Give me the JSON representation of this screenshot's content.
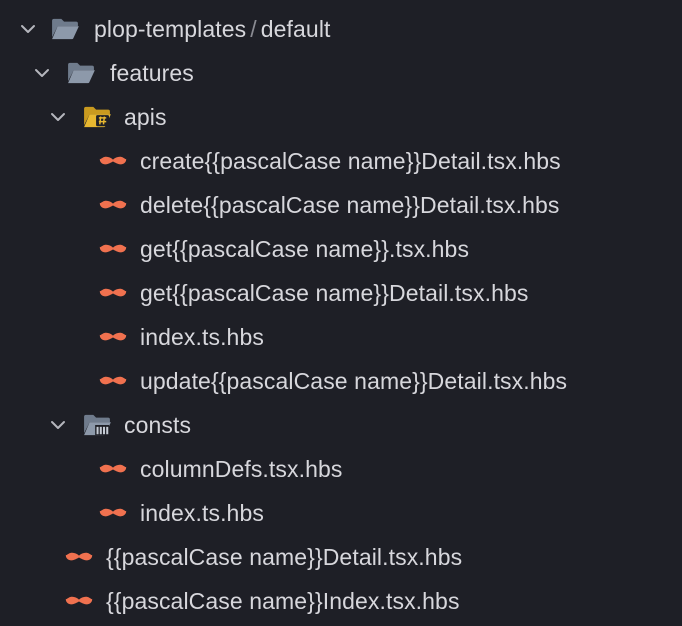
{
  "tree": {
    "root": {
      "label": "plop-templates",
      "separator": "/",
      "sublabel": "default",
      "expanded": true,
      "icon": "folder-open-icon"
    },
    "features": {
      "label": "features",
      "expanded": true,
      "icon": "folder-open-icon"
    },
    "apis": {
      "label": "apis",
      "expanded": true,
      "icon": "folder-api-icon"
    },
    "apis_files": [
      {
        "label": "create{{pascalCase name}}Detail.tsx.hbs",
        "icon": "handlebars-icon"
      },
      {
        "label": "delete{{pascalCase name}}Detail.tsx.hbs",
        "icon": "handlebars-icon"
      },
      {
        "label": "get{{pascalCase name}}.tsx.hbs",
        "icon": "handlebars-icon"
      },
      {
        "label": "get{{pascalCase name}}Detail.tsx.hbs",
        "icon": "handlebars-icon"
      },
      {
        "label": "index.ts.hbs",
        "icon": "handlebars-icon"
      },
      {
        "label": "update{{pascalCase name}}Detail.tsx.hbs",
        "icon": "handlebars-icon"
      }
    ],
    "consts": {
      "label": "consts",
      "expanded": true,
      "icon": "folder-consts-icon"
    },
    "consts_files": [
      {
        "label": "columnDefs.tsx.hbs",
        "icon": "handlebars-icon"
      },
      {
        "label": "index.ts.hbs",
        "icon": "handlebars-icon"
      }
    ],
    "feature_files": [
      {
        "label": "{{pascalCase name}}Detail.tsx.hbs",
        "icon": "handlebars-icon"
      },
      {
        "label": "{{pascalCase name}}Index.tsx.hbs",
        "icon": "handlebars-icon"
      }
    ]
  },
  "colors": {
    "background": "#1e1f26",
    "text": "#d7d7dc",
    "chevron": "#b5b6bd",
    "folder": "#8b97a8",
    "folder_api_accent": "#e8b830",
    "handlebars": "#f0714f"
  }
}
